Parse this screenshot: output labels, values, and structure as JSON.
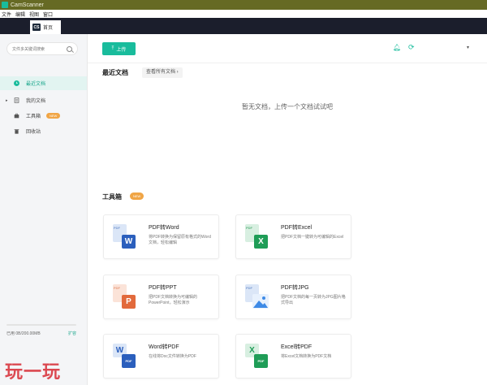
{
  "window": {
    "title": "CamScanner"
  },
  "menubar": [
    "文件",
    "编辑",
    "视图",
    "窗口"
  ],
  "tab": {
    "logo": "CS",
    "label": "首页"
  },
  "sidebar": {
    "search_placeholder": "文件多关键词搜索",
    "items": [
      {
        "label": "最近文档",
        "active": true
      },
      {
        "label": "我的文档"
      },
      {
        "label": "工具箱",
        "badge": "NEW"
      },
      {
        "label": "回收站"
      }
    ],
    "storage": {
      "used_text": "已用 0B/200.00MB",
      "expand_label": "扩容",
      "fraction": 0.0
    }
  },
  "topbar": {
    "upload_label": "上传"
  },
  "recent": {
    "title": "最近文档",
    "view_all": "查看所有文档 ›",
    "empty_message": "暂无文档，上传一个文档试试吧"
  },
  "tools": {
    "title": "工具箱",
    "badge": "NEW",
    "cards": [
      {
        "title": "PDF转Word",
        "desc": "将PDF转换为保留原有格式的Word文档，轻松编辑",
        "icon": "word",
        "color": "#2b5fbd",
        "letter": "W"
      },
      {
        "title": "PDF转Excel",
        "desc": "把PDF文档一键转为可编辑的Excel",
        "icon": "excel",
        "color": "#1f9d57",
        "letter": "X"
      },
      {
        "title": "PDF转PPT",
        "desc": "把PDF文档转换为可编辑的PowerPoint，轻松演示",
        "icon": "ppt",
        "color": "#e26a3c",
        "letter": "P"
      },
      {
        "title": "PDF转JPG",
        "desc": "把PDF文档的每一页转为JPG图片格式导出",
        "icon": "jpg",
        "color": "#3e8ae6",
        "letter": ""
      },
      {
        "title": "Word转PDF",
        "desc": "在线将Doc文件转换为PDF",
        "icon": "word2pdf",
        "color": "#2b5fbd",
        "letter": "W"
      },
      {
        "title": "Excel转PDF",
        "desc": "将Excel文档转换为PDF文档",
        "icon": "excel2pdf",
        "color": "#1f9d57",
        "letter": "X"
      }
    ]
  },
  "watermark": "玩一玩"
}
